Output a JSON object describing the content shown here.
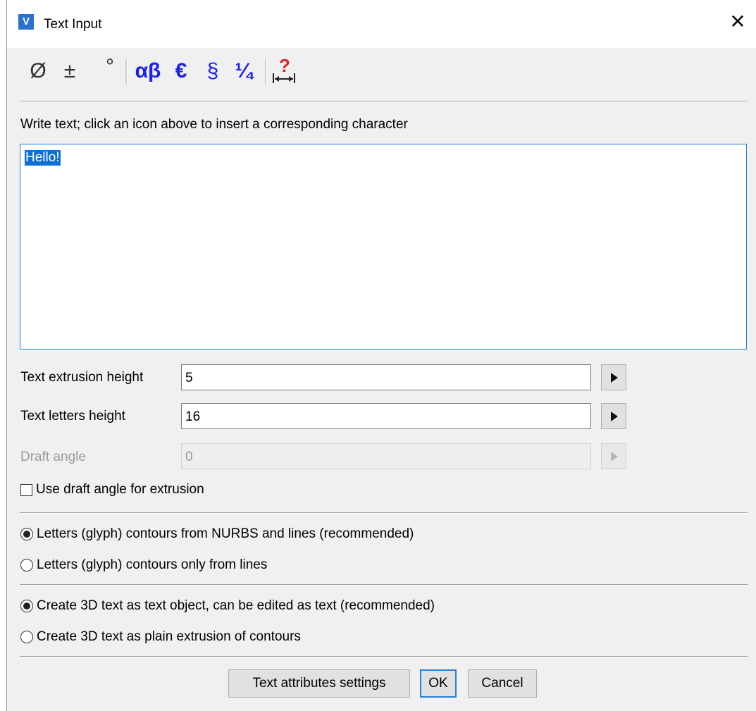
{
  "window": {
    "title": "Text Input",
    "app_icon": "V",
    "close_glyph": "✕"
  },
  "toolbar": {
    "items": [
      {
        "glyph": "Ø",
        "icon": "diameter-icon"
      },
      {
        "glyph": "±",
        "icon": "plus-minus-icon"
      },
      {
        "glyph": "°",
        "icon": "degree-icon"
      },
      {
        "glyph": "αβ",
        "icon": "greek-letters-icon"
      },
      {
        "glyph": "€",
        "icon": "euro-icon"
      },
      {
        "glyph": "§",
        "icon": "section-sign-icon"
      },
      {
        "glyph": "¼",
        "icon": "fraction-icon"
      },
      {
        "glyph": "?",
        "icon": "help-width-icon"
      }
    ]
  },
  "instruction": "Write text; click an icon above to insert a corresponding character",
  "text_value": "Hello!",
  "fields": {
    "extrusion_label": "Text extrusion height",
    "extrusion_value": "5",
    "letters_label": "Text letters height",
    "letters_value": "16",
    "draft_label": "Draft angle",
    "draft_value": "0"
  },
  "use_draft_checkbox": {
    "label": "Use draft angle for extrusion",
    "checked": false
  },
  "contours_group": [
    {
      "label": "Letters (glyph) contours from NURBS and lines (recommended)",
      "selected": true
    },
    {
      "label": "Letters (glyph) contours only from lines",
      "selected": false
    }
  ],
  "create_group": [
    {
      "label": "Create 3D text as text object, can be edited as text (recommended)",
      "selected": true
    },
    {
      "label": "Create 3D text as plain extrusion of contours",
      "selected": false
    }
  ],
  "buttons": {
    "attributes": "Text attributes settings",
    "ok": "OK",
    "cancel": "Cancel"
  },
  "colors": {
    "accent": "#2a7fd4",
    "symbol_blue": "#1a21e8",
    "selection": "#0a6fd6",
    "help_red": "#e02020"
  }
}
